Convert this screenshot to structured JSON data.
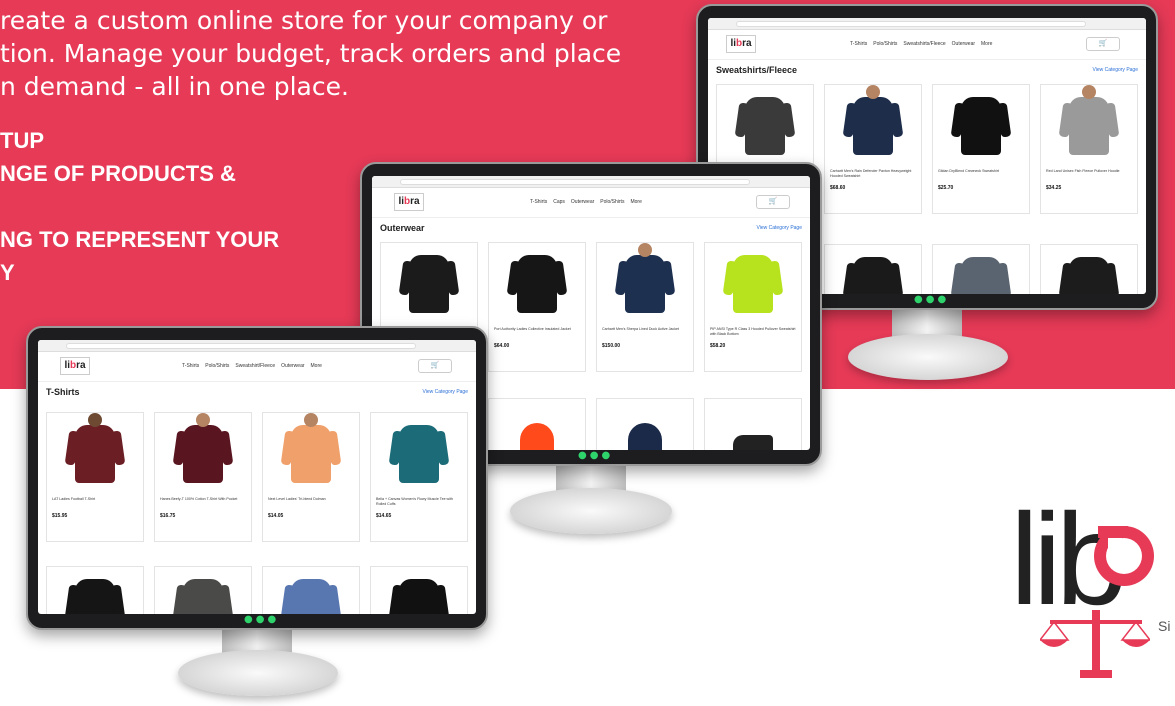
{
  "headline": {
    "lines": [
      "reate a custom online store for your company or",
      "tion. Manage your budget, track orders and place",
      "n demand - all in one place."
    ]
  },
  "bullets": [
    "TUP",
    "NGE OF PRODUCTS &",
    "",
    "NG TO REPRESENT YOUR",
    "Y"
  ],
  "colors": {
    "banner": "#e63a57",
    "accent": "#e63a57",
    "power_led": "#2fd36b"
  },
  "monitors": {
    "back": {
      "nav": [
        "T-Shirts",
        "Polo/Shirts",
        "Sweatshirts/Fleece",
        "Outerwear",
        "More"
      ],
      "category": "Sweatshirts/Fleece",
      "view_link": "View Category Page",
      "products": [
        {
          "name": "",
          "price": "",
          "color": "#3a3a3a"
        },
        {
          "name": "Carhartt Men's Rain Defender Paxton Heavyweight Hooded Sweatshirt",
          "price": "$68.60",
          "color": "#1d2d4a"
        },
        {
          "name": "Gildan DryBlend Crewneck Sweatshirt",
          "price": "$25.70",
          "color": "#111111"
        },
        {
          "name": "Red Land Unisex Fish Fleece Pullover Hoodie",
          "price": "$34.25",
          "color": "#9a9a9a"
        }
      ]
    },
    "middle": {
      "nav": [
        "T-Shirts",
        "Caps",
        "Outerwear",
        "Polo/Shirts",
        "More"
      ],
      "category": "Outerwear",
      "view_link": "View Category Page",
      "products": [
        {
          "name": "",
          "price": "",
          "color": "#1b1b1b"
        },
        {
          "name": "Port Authority Ladies Collective Insulated Jacket",
          "price": "$64.00",
          "color": "#161616"
        },
        {
          "name": "Carhartt Men's Sherpa Lined Duck Active Jacket",
          "price": "$150.00",
          "color": "#1e3050"
        },
        {
          "name": "PIP ANSI Type R Class 3 Hooded Pullover Sweatshirt with Black Bottom",
          "price": "$58.20",
          "color": "#b7e21e"
        }
      ]
    },
    "front": {
      "nav": [
        "T-Shirts",
        "Polo/Shirts",
        "Sweatshirt/Fleece",
        "Outerwear",
        "More"
      ],
      "category": "T-Shirts",
      "view_link": "View Category Page",
      "products": [
        {
          "name": "LAT Ladies Football T-Shirt",
          "price": "$15.95",
          "color": "#6b1e24"
        },
        {
          "name": "Hanes Beefy-T 100% Cotton T-Shirt With Pocket",
          "price": "$16.75",
          "color": "#5a1620"
        },
        {
          "name": "Next Level Ladies' Tri-blend Dolman",
          "price": "$14.05",
          "color": "#f0a06a"
        },
        {
          "name": "Bella + Canvas Women's Flowy Muscle Tee with Rolled Cuffs",
          "price": "$14.65",
          "color": "#1b6c78"
        }
      ]
    }
  },
  "logo": {
    "letters": "lib",
    "since": "Si"
  }
}
